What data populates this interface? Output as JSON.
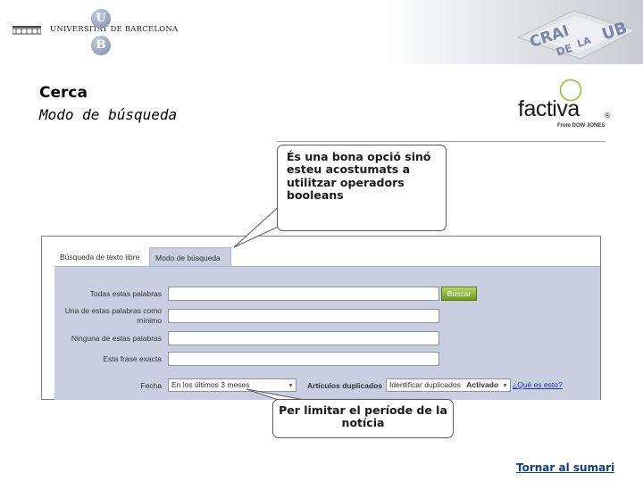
{
  "header": {
    "university_name": "UNIVERSITAT DE BARCELONA",
    "ub_letters": [
      "U",
      "B"
    ],
    "crai_logo_text": {
      "crai": "CRAI",
      "de": "DE",
      "la": "LA",
      "ub": "UB"
    }
  },
  "slide": {
    "title": "Cerca",
    "subtitle": "Modo de búsqueda"
  },
  "factiva": {
    "word": "factiva",
    "registered": "®",
    "tagline": "From DOW JONES"
  },
  "callouts": {
    "top": "És una bona opció sinó esteu acostumats a utilitzar operadors booleans",
    "bottom": "Per limitar el període de la notícia"
  },
  "search_ui": {
    "tabs": [
      "Búsqueda de texto libre",
      "Modo de búsqueda"
    ],
    "active_tab": 1,
    "fields": [
      {
        "label": "Todas estas palabras",
        "value": ""
      },
      {
        "label": "Una de estas palabras como mínimo",
        "value": ""
      },
      {
        "label": "Ninguna de estas palabras",
        "value": ""
      },
      {
        "label": "Esta frase exacta",
        "value": ""
      }
    ],
    "search_button": "Buscar",
    "date_label": "Fecha",
    "date_value": "En los últimos 3 meses",
    "duplicates_label": "Artículos duplicados",
    "duplicates_value": "Identificar duplicados",
    "duplicates_status": "Activado",
    "help_link": "¿Qué es esto?"
  },
  "footer": {
    "back_link": "Tornar al sumari"
  },
  "colors": {
    "panel": "#c9cfe0",
    "button_green": "#6f9a1f",
    "link_blue": "#123e7a",
    "factiva_ring": "#8cc63f"
  }
}
